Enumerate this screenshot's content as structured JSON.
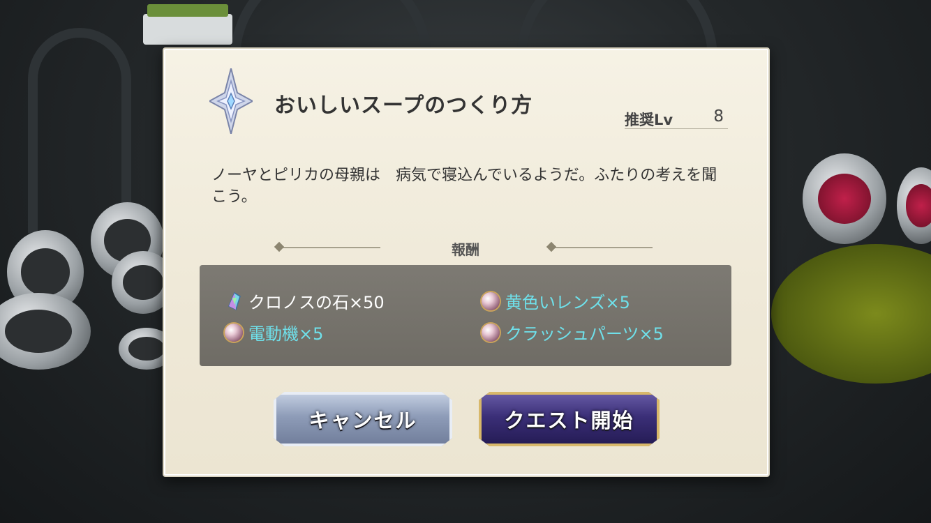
{
  "quest": {
    "title": "おいしいスープのつくり方",
    "recommended_label": "推奨Lv",
    "recommended_level": "8",
    "description": "ノーヤとピリカの母親は　病気で寝込んでいるようだ。ふたりの考えを聞こう。"
  },
  "rewards": {
    "heading": "報酬",
    "items": [
      {
        "label": "クロノスの石×50",
        "icon": "chronos-stone-icon",
        "color": "#ffffff"
      },
      {
        "label": "黄色いレンズ×5",
        "icon": "pearl-icon",
        "color": "#6fe0ea"
      },
      {
        "label": "電動機×5",
        "icon": "pearl-icon",
        "color": "#6fe0ea"
      },
      {
        "label": "クラッシュパーツ×5",
        "icon": "pearl-icon",
        "color": "#6fe0ea"
      }
    ]
  },
  "buttons": {
    "cancel": "キャンセル",
    "start": "クエスト開始"
  }
}
